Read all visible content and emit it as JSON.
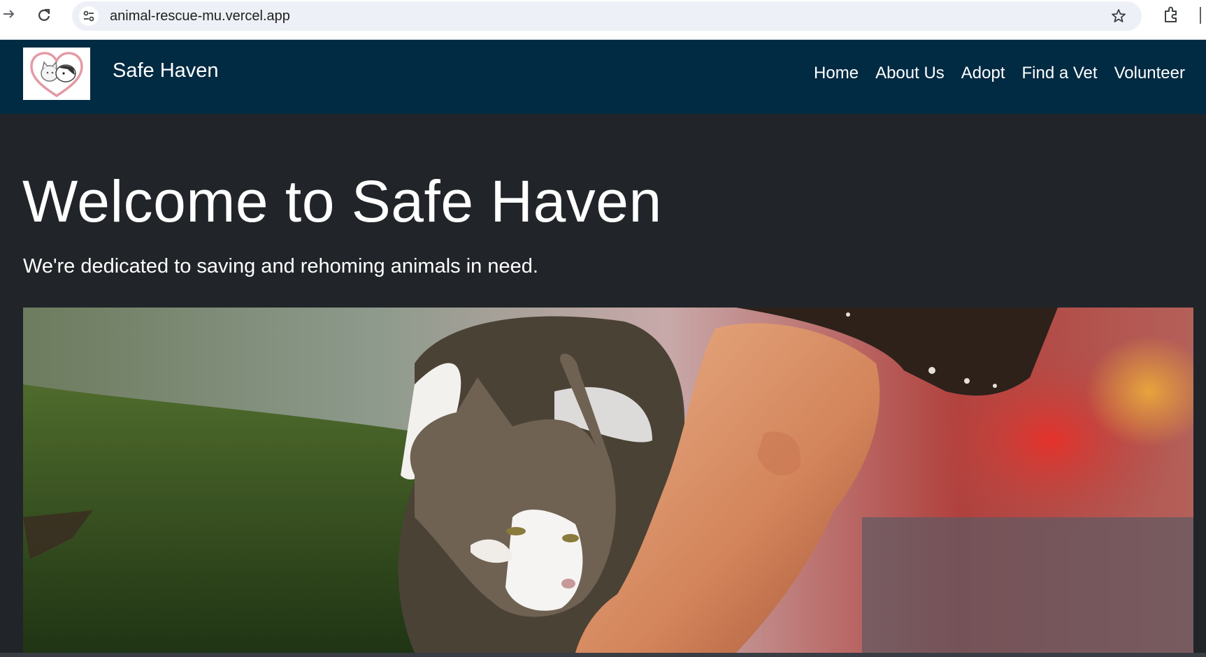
{
  "browser": {
    "url": "animal-rescue-mu.vercel.app",
    "icons": [
      "forward-arrow-icon",
      "reload-icon",
      "site-info-icon",
      "bookmark-star-icon",
      "extensions-icon"
    ]
  },
  "navbar": {
    "brand": "Safe Haven",
    "logo_icon": "heart-cat-dog-logo",
    "links": [
      "Home",
      "About Us",
      "Adopt",
      "Find a Vet",
      "Volunteer"
    ],
    "background": "#012a43"
  },
  "hero": {
    "title": "Welcome to Safe Haven",
    "subtitle": "We're dedicated to saving and rehoming animals in need."
  },
  "colors": {
    "page_background": "#212529",
    "navbar": "#012a43",
    "text": "#ffffff"
  }
}
